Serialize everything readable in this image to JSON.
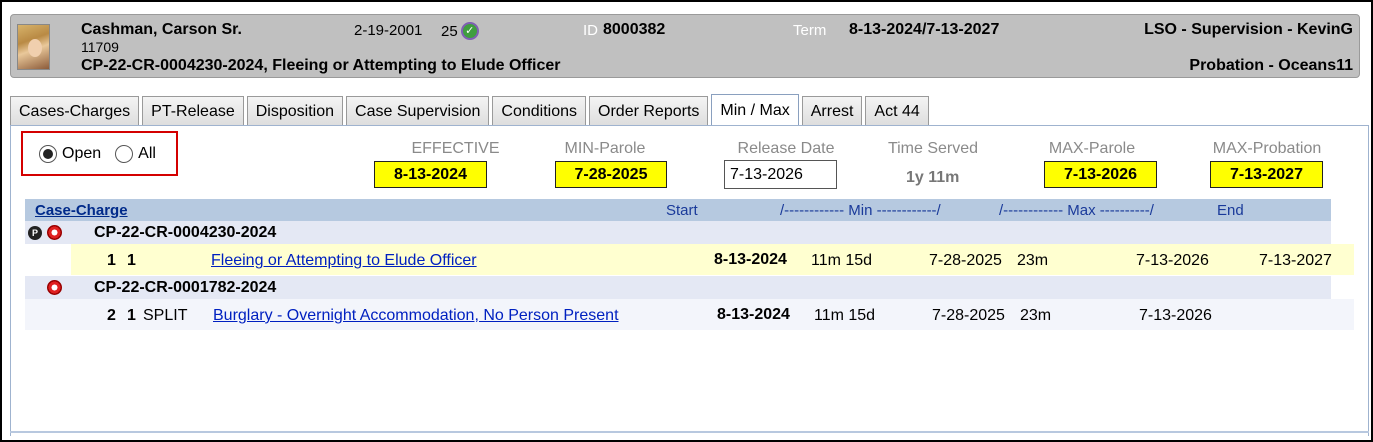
{
  "header": {
    "name": "Cashman, Carson Sr.",
    "sub_id": "11709",
    "case_title": "CP-22-CR-0004230-2024, Fleeing or Attempting to Elude Officer",
    "dob": "2-19-2001",
    "age": "25",
    "id_label": "ID",
    "id_value": "8000382",
    "term_label": "Term",
    "term_value": "8-13-2024/7-13-2027",
    "supervision": "LSO - Supervision - KevinG",
    "probation": "Probation - Oceans11"
  },
  "tabs": [
    {
      "label": "Cases-Charges"
    },
    {
      "label": "PT-Release"
    },
    {
      "label": "Disposition"
    },
    {
      "label": "Case Supervision"
    },
    {
      "label": "Conditions"
    },
    {
      "label": "Order Reports"
    },
    {
      "label": "Min / Max",
      "active": true
    },
    {
      "label": "Arrest"
    },
    {
      "label": "Act 44"
    }
  ],
  "filter": {
    "open_label": "Open",
    "all_label": "All",
    "selected": "Open"
  },
  "summary": {
    "effective_label": "EFFECTIVE",
    "effective_value": "8-13-2024",
    "min_parole_label": "MIN-Parole",
    "min_parole_value": "7-28-2025",
    "release_label": "Release Date",
    "release_value": "7-13-2026",
    "time_served_label": "Time Served",
    "time_served_value": "1y 11m",
    "max_parole_label": "MAX-Parole",
    "max_parole_value": "7-13-2026",
    "max_probation_label": "MAX-Probation",
    "max_probation_value": "7-13-2027"
  },
  "table": {
    "col_case_charge": "Case-Charge",
    "col_start": "Start",
    "col_min": "/------------ Min ------------/",
    "col_max": "/------------ Max ----------/",
    "col_end": "End",
    "cases": [
      {
        "case_number": "CP-22-CR-0004230-2024",
        "charge": {
          "count": "1",
          "seq": "1",
          "type": "",
          "description": "Fleeing or Attempting to Elude Officer",
          "start": "8-13-2024",
          "min_term": "11m 15d",
          "min_date": "7-28-2025",
          "max_term": "23m",
          "max_date": "7-13-2026",
          "end": "7-13-2027"
        }
      },
      {
        "case_number": "CP-22-CR-0001782-2024",
        "charge": {
          "count": "2",
          "seq": "1",
          "type": "SPLIT",
          "description": "Burglary - Overnight Accommodation, No Person Present",
          "start": "8-13-2024",
          "min_term": "11m 15d",
          "min_date": "7-28-2025",
          "max_term": "23m",
          "max_date": "7-13-2026",
          "end": ""
        }
      }
    ]
  },
  "colors": {
    "header_bg": "#c0c0c0",
    "highlight_yellow": "#ffff00",
    "table_header_bg": "#b6c9e0",
    "selected_row_bg": "#ffffd0",
    "filter_border": "#d40000",
    "link": "#0020c0"
  }
}
